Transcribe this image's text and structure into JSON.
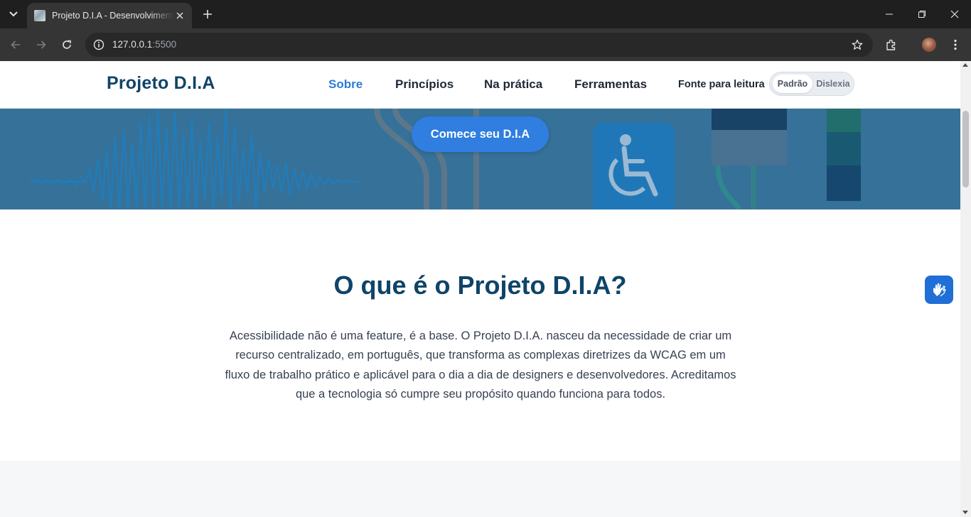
{
  "browser": {
    "tab": {
      "title": "Projeto D.I.A - Desenvolvimento Inclusivo e Acessível"
    },
    "url": {
      "host": "127.0.0.1",
      "port": ":5500"
    },
    "icons": [
      "tab-search-icon",
      "close-icon",
      "plus-icon",
      "minimize-icon",
      "restore-icon",
      "close-window-icon",
      "back-arrow-icon",
      "forward-arrow-icon",
      "reload-icon",
      "site-info-icon",
      "bookmark-star-icon",
      "extensions-icon",
      "avatar",
      "kebab-menu-icon"
    ]
  },
  "site": {
    "brand": "Projeto D.I.A",
    "nav": [
      {
        "label": "Sobre",
        "active": true
      },
      {
        "label": "Princípios",
        "active": false
      },
      {
        "label": "Na prática",
        "active": false
      },
      {
        "label": "Ferramentas",
        "active": false
      }
    ],
    "font_toggle": {
      "label": "Fonte para leitura",
      "options": [
        "Padrão",
        "Dislexia"
      ],
      "selected": "Padrão"
    }
  },
  "hero": {
    "cta_label": "Comece seu D.I.A"
  },
  "about": {
    "title": "O que é o Projeto D.I.A?",
    "lines": [
      "Acessibilidade não é uma feature, é a base. O Projeto D.I.A. nasceu da necessidade de criar um",
      "recurso centralizado, em português, que transforma as complexas diretrizes da WCAG em um",
      "fluxo de trabalho prático e aplicável para o dia a dia de designers e desenvolvedores. Acreditamos",
      "que a tecnologia só cumpre seu propósito quando funciona para todos."
    ]
  },
  "widgets": {
    "vlibras_icon": "sign-language-hands-icon"
  },
  "colors": {
    "brand": "#0f4468",
    "accent": "#2e7bd9",
    "cta": "#2f7ee0",
    "hero": "#3f7ea6"
  }
}
